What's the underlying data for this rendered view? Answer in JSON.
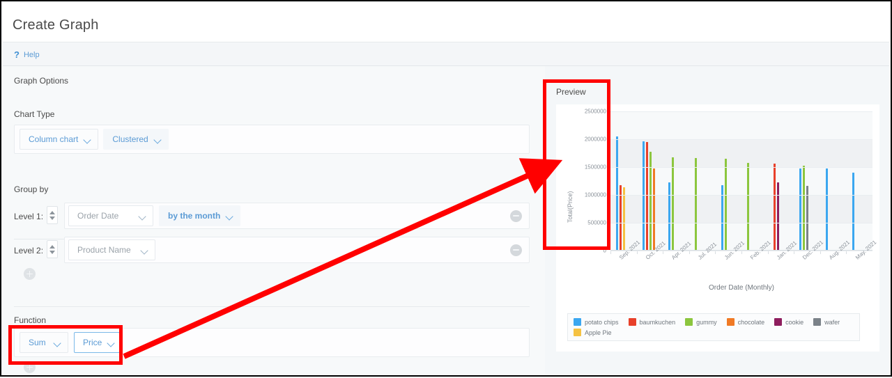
{
  "header": {
    "title": "Create Graph"
  },
  "helpbar": {
    "icon": "question-icon",
    "label": "Help"
  },
  "options": {
    "section_title": "Graph Options",
    "chart_type": {
      "label": "Chart Type",
      "type_value": "Column chart",
      "style_value": "Clustered"
    },
    "group_by": {
      "label": "Group by",
      "level1_label": "Level 1:",
      "level1_field": "Order Date",
      "level1_granularity": "by the month",
      "level2_label": "Level 2:",
      "level2_field": "Product Name"
    },
    "function": {
      "label": "Function",
      "aggregate": "Sum",
      "field": "Price"
    }
  },
  "preview": {
    "title": "Preview"
  },
  "colors": {
    "potato_chips": "#3ba7f0",
    "baumkuchen": "#e8402a",
    "gummy": "#8cc63e",
    "chocolate": "#f07a25",
    "cookie": "#8e1e5e",
    "wafer": "#7b8289",
    "apple_pie": "#f5c242",
    "accent_blue": "#5b9bd5",
    "annotation_red": "#ff0000"
  },
  "chart_data": {
    "type": "bar",
    "title": "",
    "xlabel": "Order Date (Monthly)",
    "ylabel": "Total(Price)",
    "ylim": [
      0,
      2500000
    ],
    "yticks": [
      0,
      500000,
      1000000,
      1500000,
      2000000,
      2500000
    ],
    "ytick_labels": [
      "0",
      "500000",
      "1000000",
      "1500000",
      "2000000",
      "2500000"
    ],
    "grid": true,
    "legend_position": "bottom",
    "categories": [
      "Sep. 2021",
      "Oct. 2021",
      "Apr. 2021",
      "Jul. 2021",
      "Jun. 2021",
      "Feb. 2021",
      "Jan. 2021",
      "Dec. 2021",
      "Aug. 2021",
      "May. 2021"
    ],
    "series": [
      {
        "name": "potato chips",
        "color": "#3ba7f0",
        "values": [
          2050000,
          1960000,
          1230000,
          null,
          1170000,
          null,
          null,
          1480000,
          1470000,
          1400000
        ]
      },
      {
        "name": "baumkuchen",
        "color": "#e8402a",
        "values": [
          1180000,
          1950000,
          null,
          null,
          null,
          null,
          1560000,
          null,
          null,
          null
        ]
      },
      {
        "name": "gummy",
        "color": "#8cc63e",
        "values": [
          null,
          1780000,
          1670000,
          1660000,
          1650000,
          1580000,
          null,
          1530000,
          null,
          null
        ]
      },
      {
        "name": "chocolate",
        "color": "#f07a25",
        "values": [
          null,
          1480000,
          null,
          null,
          null,
          null,
          null,
          null,
          null,
          null
        ]
      },
      {
        "name": "cookie",
        "color": "#8e1e5e",
        "values": [
          null,
          null,
          null,
          null,
          null,
          null,
          1220000,
          null,
          null,
          null
        ]
      },
      {
        "name": "wafer",
        "color": "#7b8289",
        "values": [
          null,
          null,
          null,
          null,
          null,
          null,
          null,
          1160000,
          null,
          null
        ]
      },
      {
        "name": "Apple Pie",
        "color": "#f5c242",
        "values": [
          1140000,
          null,
          null,
          null,
          null,
          null,
          null,
          null,
          null,
          null
        ]
      }
    ]
  }
}
